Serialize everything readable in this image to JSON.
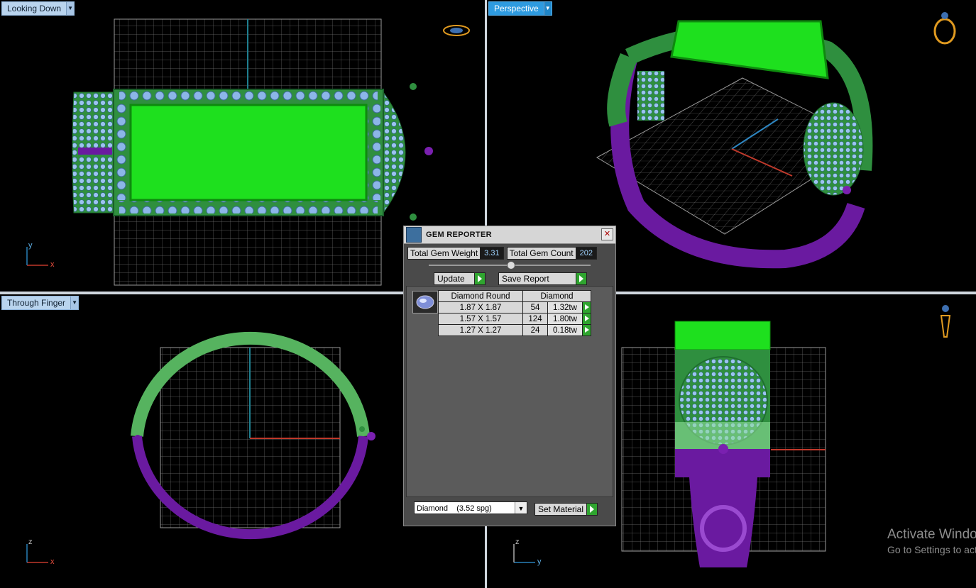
{
  "viewports": {
    "top_left": {
      "label": "Looking Down",
      "axes": [
        "y",
        "x"
      ]
    },
    "top_right": {
      "label": "Perspective"
    },
    "bottom_left": {
      "label": "Through Finger",
      "axes": [
        "z",
        "x"
      ]
    },
    "bottom_right": {
      "axes": [
        "z",
        "y"
      ]
    }
  },
  "gem_reporter": {
    "title": "GEM REPORTER",
    "close_label": "✕",
    "total_weight_label": "Total Gem Weight",
    "total_weight_value": "3.31",
    "total_count_label": "Total Gem Count",
    "total_count_value": "202",
    "update_label": "Update",
    "save_report_label": "Save Report",
    "table": {
      "header_shape": "Diamond Round",
      "header_material": "Diamond",
      "rows": [
        {
          "size": "1.87 X 1.87",
          "count": "54",
          "weight": "1.32tw"
        },
        {
          "size": "1.57 X 1.57",
          "count": "124",
          "weight": "1.80tw"
        },
        {
          "size": "1.27 X 1.27",
          "count": "24",
          "weight": "0.18tw"
        }
      ]
    },
    "material_value": "Diamond    (3.52 spg)",
    "set_material_label": "Set Material"
  },
  "watermark": {
    "line1": "Activate Windows",
    "line2": "Go to Settings to activate Windows."
  },
  "colors": {
    "metal_green": "#2f8f3f",
    "metal_bright": "#1ee01e",
    "metal_purple": "#6a1aa0",
    "gem_blue": "#8cb6e8",
    "grid": "#7a7a7a"
  }
}
